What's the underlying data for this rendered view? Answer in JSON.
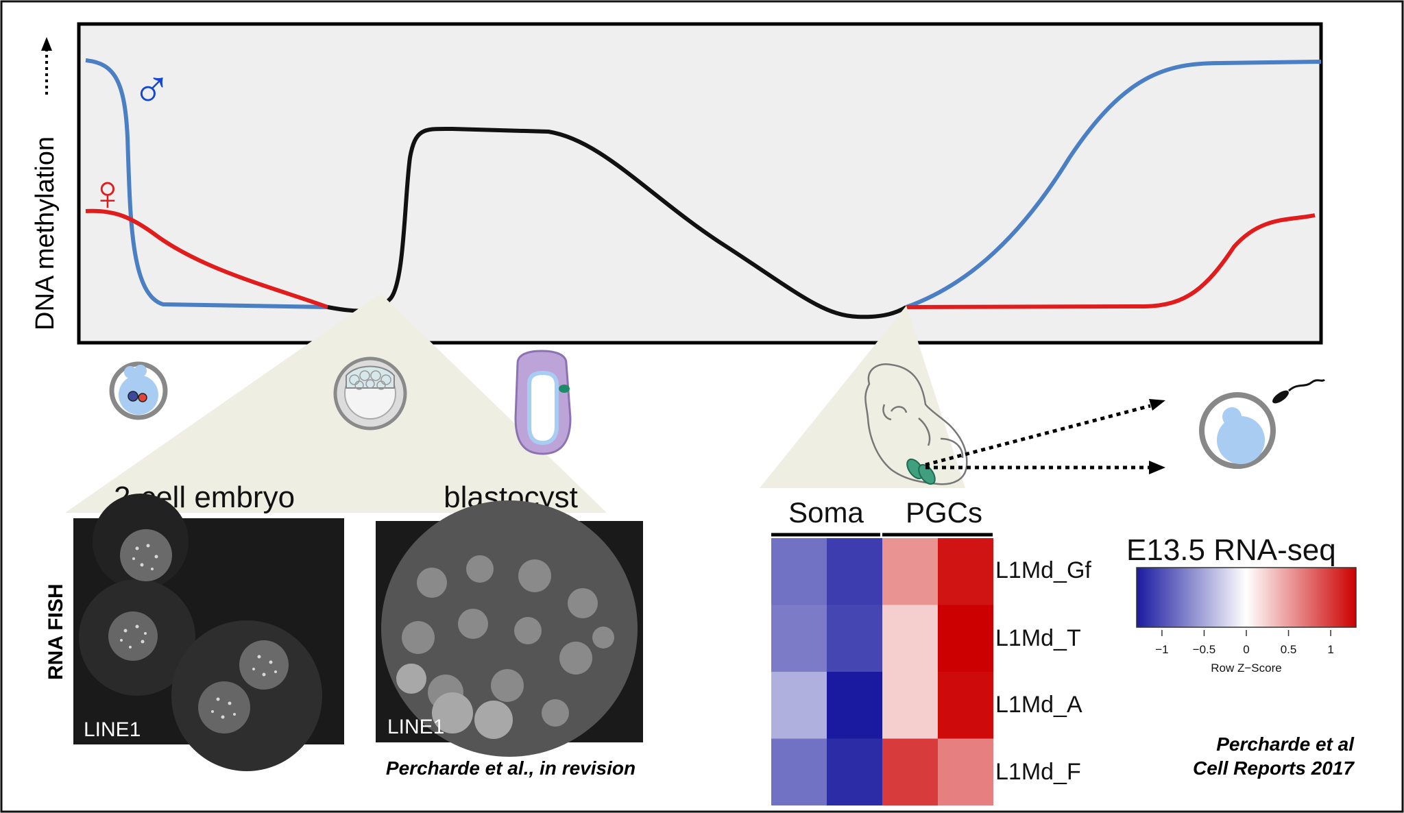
{
  "plot": {
    "ylabel": "DNA methylation",
    "male_symbol": "♂",
    "female_symbol": "♀",
    "colors": {
      "male": "#4a7fc4",
      "female": "#e01c1c",
      "embryo": "#111111",
      "panel_bg": "#efefef",
      "wedge": "#eeeee2"
    }
  },
  "left_panel": {
    "side_label": "RNA FISH",
    "image1": {
      "title": "2-cell embryo",
      "label": "LINE1"
    },
    "image2": {
      "title": "blastocyst",
      "label": "LINE1"
    },
    "citation": "Percharde et al., in revision"
  },
  "heatmap": {
    "group_labels": [
      "Soma",
      "PGCs"
    ],
    "rows": [
      "L1Md_Gf",
      "L1Md_T",
      "L1Md_A",
      "L1Md_F"
    ],
    "zscores": [
      [
        -0.8,
        -1.1,
        0.55,
        1.2
      ],
      [
        -0.75,
        -1.05,
        0.25,
        1.35
      ],
      [
        -0.45,
        -1.35,
        0.25,
        1.25
      ],
      [
        -0.8,
        -1.2,
        1.0,
        0.65
      ]
    ],
    "colors": {
      "low": "#1a1aa0",
      "mid": "#ffffff",
      "high": "#cc0000"
    }
  },
  "legend": {
    "title": "E13.5 RNA-seq",
    "ticks": [
      "−1",
      "−0.5",
      "0",
      "0.5",
      "1"
    ],
    "tick_values": [
      -1,
      -0.5,
      0,
      0.5,
      1
    ],
    "range": [
      -1.3,
      1.3
    ],
    "caption": "Row Z−Score"
  },
  "citation_right": {
    "line1": "Percharde et al",
    "line2": "Cell Reports 2017"
  }
}
